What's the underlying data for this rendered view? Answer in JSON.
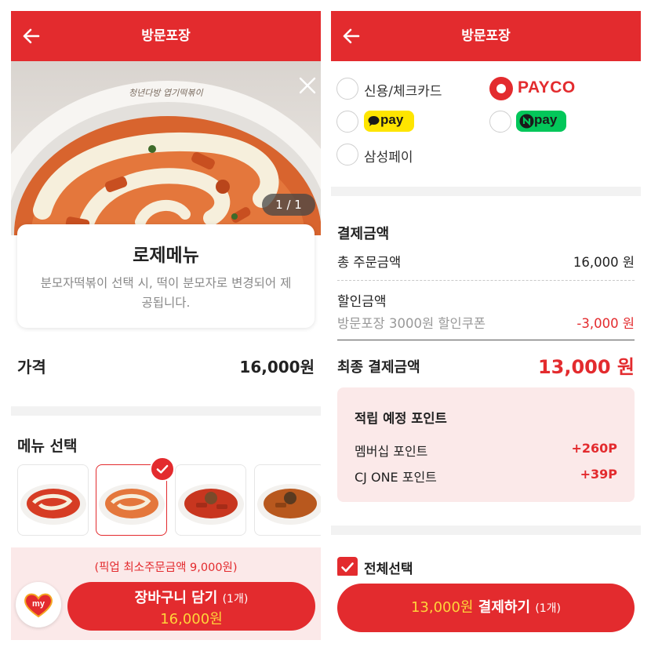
{
  "left": {
    "header": {
      "title": "방문포장",
      "back_icon": "arrow-left-icon"
    },
    "hero": {
      "pager": "1 / 1",
      "brand_text": "청년다방 엽기떡볶이"
    },
    "menu": {
      "name": "로제메뉴",
      "description": "분모자떡볶이 선택 시, 떡이 분모자로 변경되어 제공됩니다."
    },
    "price": {
      "label": "가격",
      "value": "16,000원"
    },
    "select": {
      "title": "메뉴 선택",
      "thumbs": [
        "rose-tteokbokki-1",
        "rose-tteokbokki-2",
        "spicy-tteokbokki",
        "jjajang-tteokbokki"
      ],
      "selected_index": 1
    },
    "bottom": {
      "min_order": "(픽업 최소주문금액 9,000원)",
      "my_badge": "my",
      "cart_label": "장바구니 담기",
      "cart_count": "(1개)",
      "cart_price": "16,000원"
    }
  },
  "right": {
    "header": {
      "title": "방문포장"
    },
    "payment_methods": {
      "card": "신용/체크카드",
      "payco": "PAYCO",
      "kakao": "pay",
      "naver": "pay",
      "samsung": "삼성페이"
    },
    "payment": {
      "title": "결제금액",
      "total_label": "총 주문금액",
      "total_value": "16,000 원",
      "discount_label": "할인금액",
      "discount_desc": "방문포장 3000원 할인쿠폰",
      "discount_value": "-3,000 원",
      "final_label": "최종 결제금액",
      "final_value": "13,000 원"
    },
    "points": {
      "title": "적립 예정 포인트",
      "membership_label": "멤버십 포인트",
      "membership_value": "+260P",
      "cjone_label": "CJ ONE 포인트",
      "cjone_value": "+39P"
    },
    "agree": {
      "all_label": "전체선택"
    },
    "pay_button": {
      "amount": "13,000원",
      "label": "결제하기",
      "count": "(1개)"
    }
  },
  "colors": {
    "brand_red": "#e32b2e",
    "highlight_yellow": "#ffd43a",
    "soft_pink": "#fbe9e9"
  }
}
